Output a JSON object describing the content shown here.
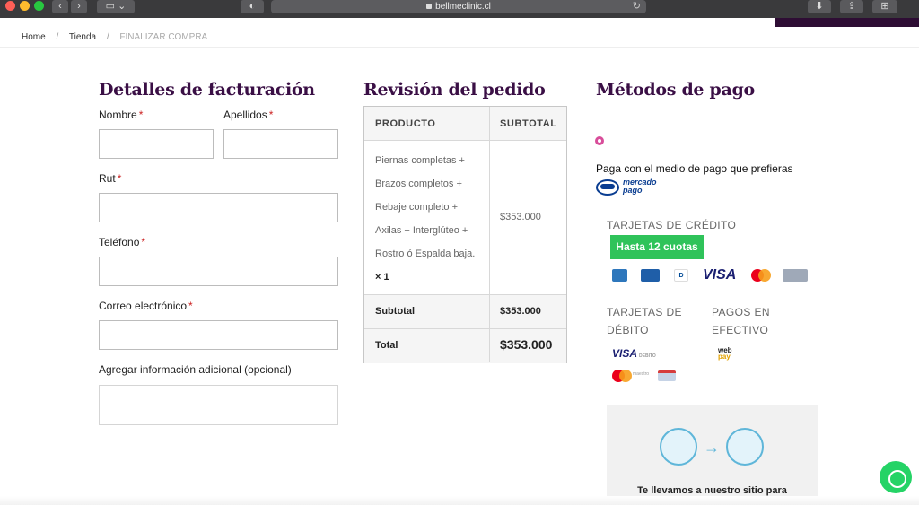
{
  "browser": {
    "url": "bellmeclinic.cl",
    "icons": [
      "back-icon",
      "forward-icon",
      "sidebar-icon",
      "shield-icon",
      "lock-icon",
      "reload-icon",
      "download-icon",
      "share-icon",
      "tab-overview-icon"
    ]
  },
  "breadcrumb": {
    "home": "Home",
    "sep": "/",
    "shop": "Tienda",
    "current": "FINALIZAR COMPRA"
  },
  "billing": {
    "title": "Detalles de facturación",
    "required_mark": "*",
    "first_name": "Nombre",
    "last_name": "Apellidos",
    "rut": "Rut",
    "phone": "Teléfono",
    "email": "Correo electrónico",
    "notes": "Agregar información adicional (opcional)"
  },
  "order": {
    "title": "Revisión del pedido",
    "col_product": "PRODUCTO",
    "col_subtotal": "SUBTOTAL",
    "product_lines": [
      "Piernas completas +",
      "Brazos completos +",
      "Rebaje completo +",
      "Axilas + Interglúteo +",
      "Rostro ó Espalda baja."
    ],
    "qty": "× 1",
    "line_total": "$353.000",
    "subtotal_label": "Subtotal",
    "subtotal_value": "$353.000",
    "total_label": "Total",
    "total_value": "$353.000"
  },
  "payment": {
    "title": "Métodos de pago",
    "method_text": "Paga con el medio de pago que prefieras",
    "mp_logo_line1": "mercado",
    "mp_logo_line2": "pago",
    "credit_title": "TARJETAS DE CRÉDITO",
    "installments": "Hasta 12 cuotas",
    "credit_brands": [
      "American Express",
      "Diners",
      "Diners Club",
      "VISA",
      "Mastercard",
      "Magna"
    ],
    "debit_title_1": "TARJETAS DE",
    "debit_title_2": "DÉBITO",
    "cash_title_1": "PAGOS EN",
    "cash_title_2": "EFECTIVO",
    "visa_label": "VISA",
    "visa_debit": "DÉBITO",
    "mc_debit": "maestro",
    "webpay_1": "web",
    "webpay_2": "pay",
    "redirect_text": "Te llevamos a nuestro sitio para"
  },
  "colors": {
    "heading": "#3a0f45",
    "accent_green": "#2fc35a",
    "radio_pink": "#d84d9a",
    "header_purple": "#2e0d34"
  }
}
